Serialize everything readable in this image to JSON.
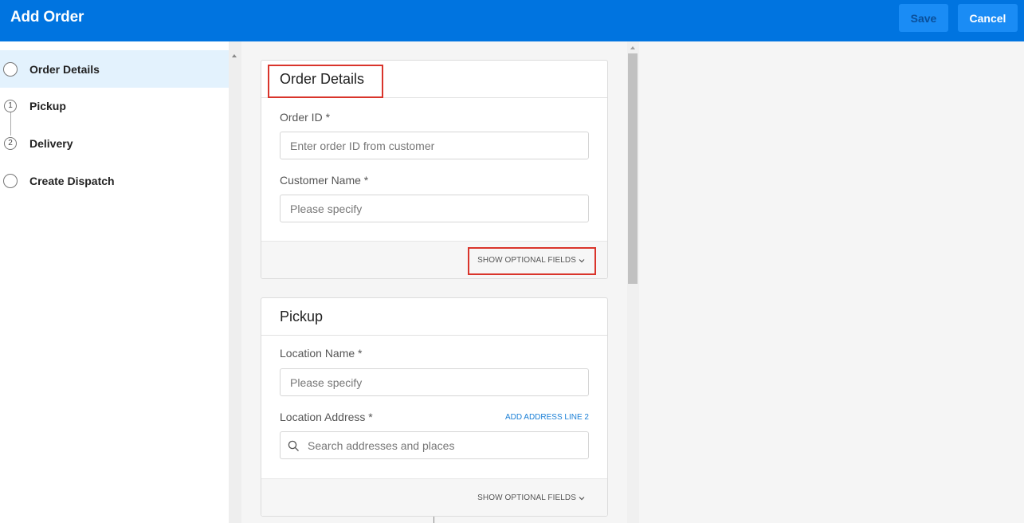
{
  "header": {
    "title": "Add Order",
    "save_label": "Save",
    "cancel_label": "Cancel",
    "color": "#0074e0"
  },
  "sidebar": {
    "steps": [
      {
        "label": "Order Details",
        "marker": "",
        "active": true
      },
      {
        "label": "Pickup",
        "marker": "1"
      },
      {
        "label": "Delivery",
        "marker": "2"
      },
      {
        "label": "Create Dispatch",
        "marker": ""
      }
    ]
  },
  "order_details": {
    "title": "Order Details",
    "order_id_label": "Order ID *",
    "order_id_placeholder": "Enter order ID from customer",
    "customer_name_label": "Customer Name *",
    "customer_name_placeholder": "Please specify",
    "optional_label": "SHOW OPTIONAL FIELDS"
  },
  "pickup": {
    "title": "Pickup",
    "location_name_label": "Location Name *",
    "location_name_placeholder": "Please specify",
    "location_address_label": "Location Address *",
    "add_address_line": "ADD ADDRESS LINE 2",
    "address_placeholder": "Search addresses and places",
    "optional_label": "SHOW OPTIONAL FIELDS"
  },
  "icons": {
    "step_marker": "circle-icon",
    "search": "search-icon",
    "chevron": "chevron-down-icon"
  },
  "colors": {
    "highlight": "#d9342b",
    "link": "#1a7fd6",
    "active_step_bg": "#e3f2fd"
  }
}
